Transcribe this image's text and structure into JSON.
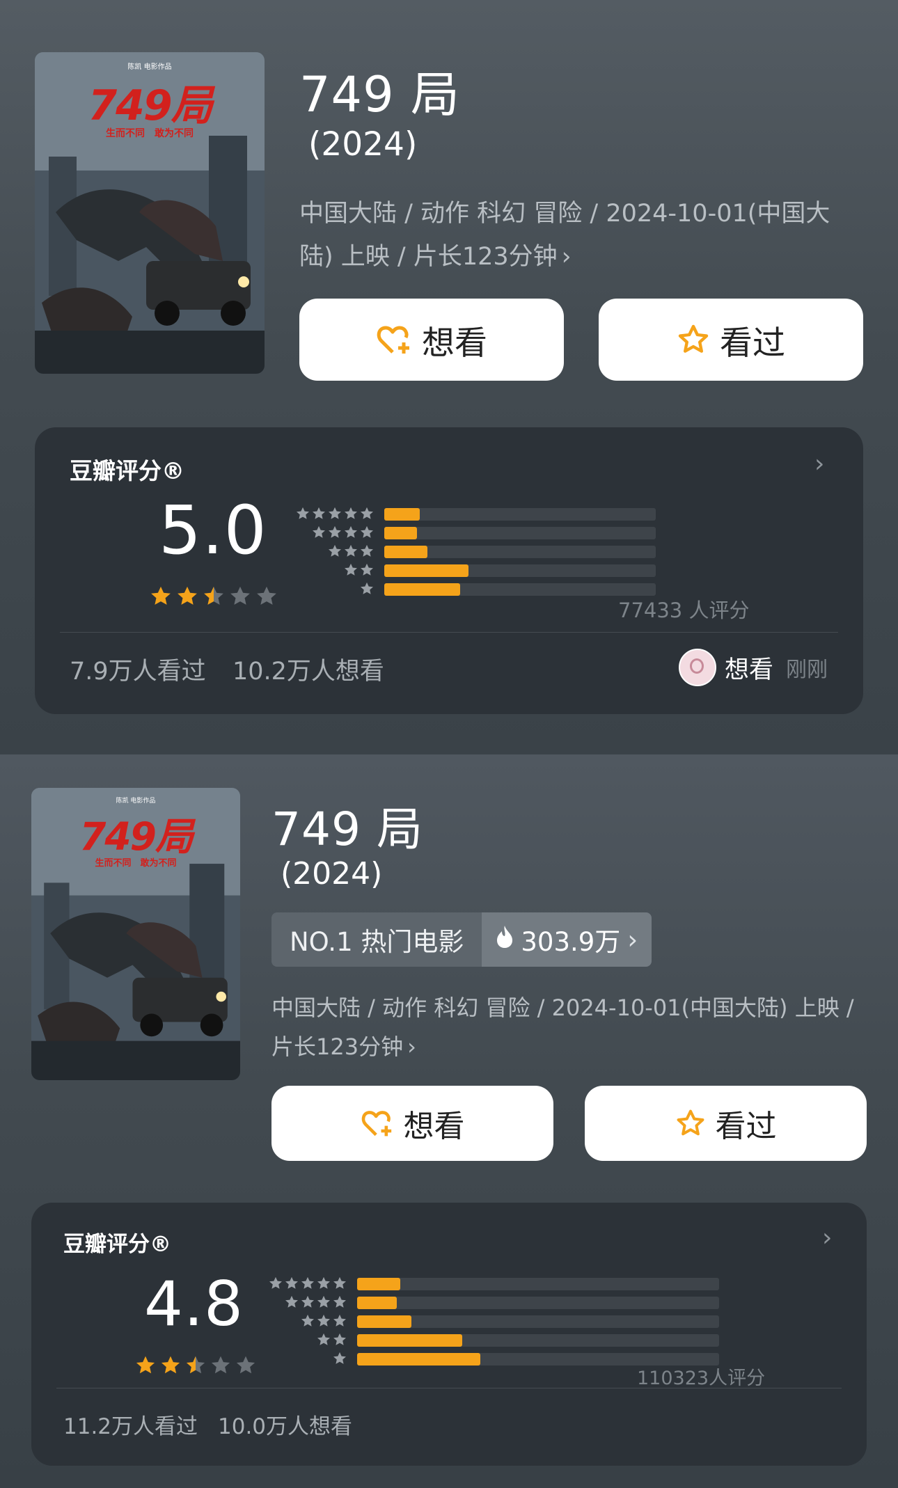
{
  "colors": {
    "accent": "#f5a31a",
    "card": "#2c3238",
    "star_empty": "#6c7278"
  },
  "entries": [
    {
      "poster": {
        "brand": "陈凯 电影作品",
        "title": "749局",
        "tagline": "生而不同　敢为不同"
      },
      "title": "749 局",
      "year": "(2024)",
      "meta": "中国大陆 / 动作 科幻 冒险 / 2024-10-01(中国大陆) 上映 / 片长123分钟",
      "buttons": {
        "want": "想看",
        "seen": "看过"
      },
      "rating": {
        "label": "豆瓣评分®",
        "score": "5.0",
        "stars": 2.5,
        "distribution": [
          {
            "stars": 5,
            "fraction": 0.13
          },
          {
            "stars": 4,
            "fraction": 0.12
          },
          {
            "stars": 3,
            "fraction": 0.16
          },
          {
            "stars": 2,
            "fraction": 0.31
          },
          {
            "stars": 1,
            "fraction": 0.28
          }
        ],
        "count": "77433 人评分",
        "seen": "7.9万人看过",
        "want": "10.2万人想看",
        "recent": {
          "action": "想看",
          "time": "刚刚"
        }
      }
    },
    {
      "poster": {
        "brand": "陈凯 电影作品",
        "title": "749局",
        "tagline": "生而不同　敢为不同"
      },
      "title": "749 局",
      "year": "(2024)",
      "rank": {
        "label": "NO.1 热门电影",
        "heat": "303.9万"
      },
      "meta": "中国大陆 / 动作 科幻 冒险 / 2024-10-01(中国大陆) 上映 / 片长123分钟",
      "buttons": {
        "want": "想看",
        "seen": "看过"
      },
      "rating": {
        "label": "豆瓣评分®",
        "score": "4.8",
        "stars": 2.5,
        "distribution": [
          {
            "stars": 5,
            "fraction": 0.12
          },
          {
            "stars": 4,
            "fraction": 0.11
          },
          {
            "stars": 3,
            "fraction": 0.15
          },
          {
            "stars": 2,
            "fraction": 0.29
          },
          {
            "stars": 1,
            "fraction": 0.34
          }
        ],
        "count": "110323人评分",
        "seen": "11.2万人看过",
        "want": "10.0万人想看"
      }
    }
  ]
}
